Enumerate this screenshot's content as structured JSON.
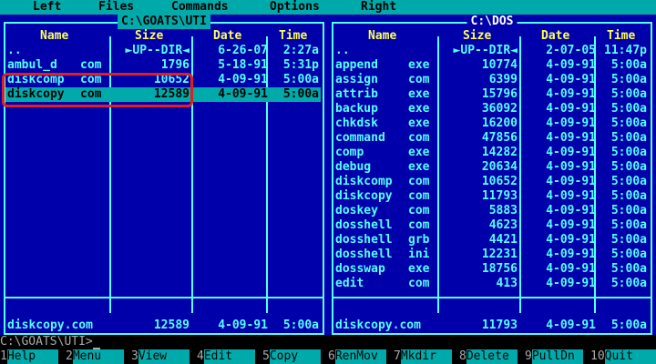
{
  "menu": {
    "left": "Left",
    "files": "Files",
    "commands": "Commands",
    "options": "Options",
    "right": "Right"
  },
  "left_panel": {
    "path": "C:\\GOATS\\UTI",
    "headers": {
      "name": "Name",
      "size": "Size",
      "date": "Date",
      "time": "Time"
    },
    "rows": [
      {
        "name": "..",
        "ext": "",
        "size": "►UP--DIR◄",
        "date": "6-26-07",
        "time": "2:27a"
      },
      {
        "name": "ambul_d",
        "ext": "com",
        "size": "1796",
        "date": "5-18-91",
        "time": "5:31p"
      },
      {
        "name": "diskcomp",
        "ext": "com",
        "size": "10652",
        "date": "4-09-91",
        "time": "5:00a"
      },
      {
        "name": "diskcopy",
        "ext": "com",
        "size": "12589",
        "date": "4-09-91",
        "time": "5:00a"
      }
    ],
    "selected_index": 3,
    "status": {
      "name": "diskcopy.com",
      "size": "12589",
      "date": "4-09-91",
      "time": "5:00a"
    }
  },
  "right_panel": {
    "path": "C:\\DOS",
    "headers": {
      "name": "Name",
      "size": "Size",
      "date": "Date",
      "time": "Time"
    },
    "rows": [
      {
        "name": "..",
        "ext": "",
        "size": "►UP--DIR◄",
        "date": "2-07-05",
        "time": "11:47p"
      },
      {
        "name": "append",
        "ext": "exe",
        "size": "10774",
        "date": "4-09-91",
        "time": "5:00a"
      },
      {
        "name": "assign",
        "ext": "com",
        "size": "6399",
        "date": "4-09-91",
        "time": "5:00a"
      },
      {
        "name": "attrib",
        "ext": "exe",
        "size": "15796",
        "date": "4-09-91",
        "time": "5:00a"
      },
      {
        "name": "backup",
        "ext": "exe",
        "size": "36092",
        "date": "4-09-91",
        "time": "5:00a"
      },
      {
        "name": "chkdsk",
        "ext": "exe",
        "size": "16200",
        "date": "4-09-91",
        "time": "5:00a"
      },
      {
        "name": "command",
        "ext": "com",
        "size": "47856",
        "date": "4-09-91",
        "time": "5:00a"
      },
      {
        "name": "comp",
        "ext": "exe",
        "size": "14282",
        "date": "4-09-91",
        "time": "5:00a"
      },
      {
        "name": "debug",
        "ext": "exe",
        "size": "20634",
        "date": "4-09-91",
        "time": "5:00a"
      },
      {
        "name": "diskcomp",
        "ext": "com",
        "size": "10652",
        "date": "4-09-91",
        "time": "5:00a"
      },
      {
        "name": "diskcopy",
        "ext": "com",
        "size": "11793",
        "date": "4-09-91",
        "time": "5:00a"
      },
      {
        "name": "doskey",
        "ext": "com",
        "size": "5883",
        "date": "4-09-91",
        "time": "5:00a"
      },
      {
        "name": "dosshell",
        "ext": "com",
        "size": "4623",
        "date": "4-09-91",
        "time": "5:00a"
      },
      {
        "name": "dosshell",
        "ext": "grb",
        "size": "4421",
        "date": "4-09-91",
        "time": "5:00a"
      },
      {
        "name": "dosshell",
        "ext": "ini",
        "size": "12231",
        "date": "4-09-91",
        "time": "5:00a"
      },
      {
        "name": "dosswap",
        "ext": "exe",
        "size": "18756",
        "date": "4-09-91",
        "time": "5:00a"
      },
      {
        "name": "edit",
        "ext": "com",
        "size": "413",
        "date": "4-09-91",
        "time": "5:00a"
      }
    ],
    "selected_index": -1,
    "status": {
      "name": "diskcopy.com",
      "size": "11793",
      "date": "4-09-91",
      "time": "5:00a"
    }
  },
  "command_line": {
    "prompt": "C:\\GOATS\\UTI>"
  },
  "function_keys": [
    {
      "num": "1",
      "label": "Help"
    },
    {
      "num": "2",
      "label": "Menu"
    },
    {
      "num": "3",
      "label": "View"
    },
    {
      "num": "4",
      "label": "Edit"
    },
    {
      "num": "5",
      "label": "Copy"
    },
    {
      "num": "6",
      "label": "RenMov"
    },
    {
      "num": "7",
      "label": "Mkdir"
    },
    {
      "num": "8",
      "label": "Delete"
    },
    {
      "num": "9",
      "label": "PullDn"
    },
    {
      "num": "10",
      "label": "Quit"
    }
  ],
  "colors": {
    "panel_bg": "#0000aa",
    "panel_fg": "#55ffff",
    "header_fg": "#ffff55",
    "cursor_bg": "#00aaaa",
    "annotation": "#e02020"
  }
}
